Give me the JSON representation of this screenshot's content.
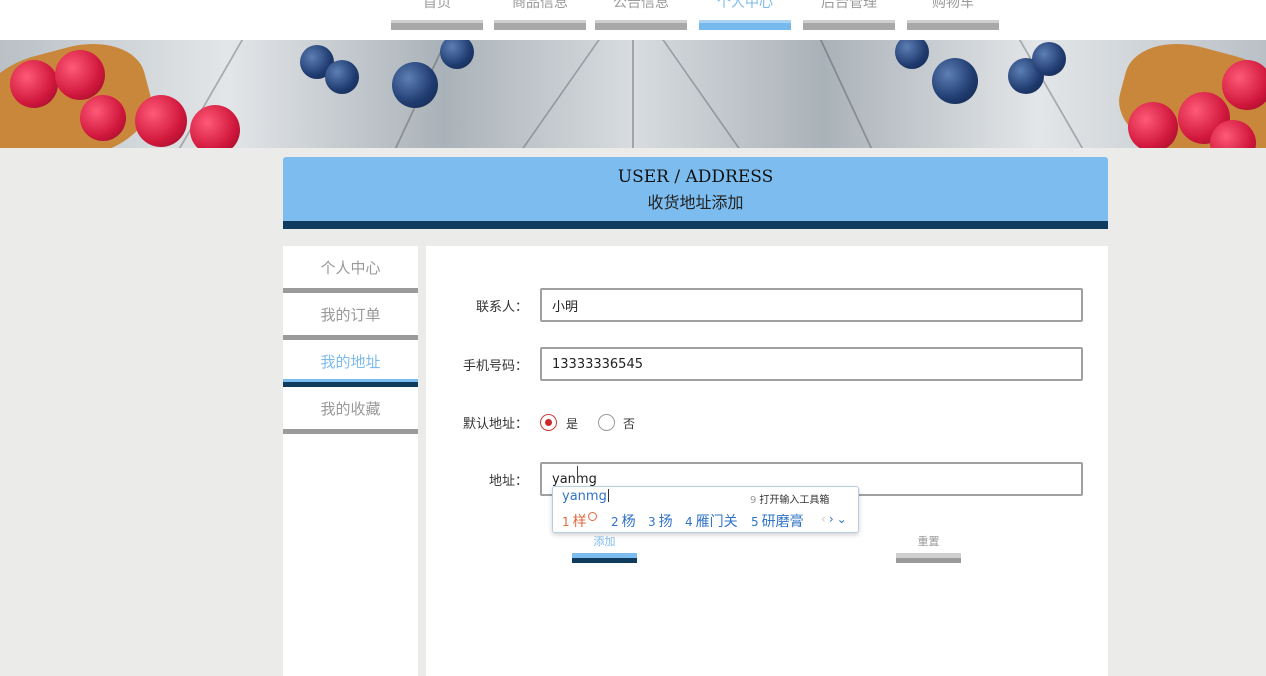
{
  "nav": {
    "items": [
      {
        "label": "首页",
        "active": false
      },
      {
        "label": "商品信息",
        "active": false
      },
      {
        "label": "公告信息",
        "active": false
      },
      {
        "label": "个人中心",
        "active": true
      },
      {
        "label": "后台管理",
        "active": false
      },
      {
        "label": "购物车",
        "active": false
      }
    ]
  },
  "header": {
    "title": "USER / ADDRESS",
    "subtitle": "收货地址添加"
  },
  "sidebar": {
    "items": [
      {
        "label": "个人中心",
        "active": false
      },
      {
        "label": "我的订单",
        "active": false
      },
      {
        "label": "我的地址",
        "active": true
      },
      {
        "label": "我的收藏",
        "active": false
      }
    ]
  },
  "form": {
    "contact_label": "联系人：",
    "contact_value": "小明",
    "phone_label": "手机号码：",
    "phone_value": "13333336545",
    "default_label": "默认地址：",
    "default_yes": "是",
    "default_no": "否",
    "default_selected": "是",
    "address_label": "地址：",
    "address_value": "yanmg",
    "add_button": "添加",
    "reset_button": "重置"
  },
  "ime": {
    "composition": "yanmg",
    "toolbox": "打开输入工具箱",
    "toolbox_key": "9",
    "candidates": [
      {
        "n": "1",
        "text": "样"
      },
      {
        "n": "2",
        "text": "杨"
      },
      {
        "n": "3",
        "text": "扬"
      },
      {
        "n": "4",
        "text": "雁门关"
      },
      {
        "n": "5",
        "text": "研磨膏"
      }
    ]
  },
  "colors": {
    "accent": "#7cbcee",
    "accent_dark": "#0f3c5e",
    "muted": "#9b9b9b",
    "radio_selected": "#c92a2a"
  }
}
